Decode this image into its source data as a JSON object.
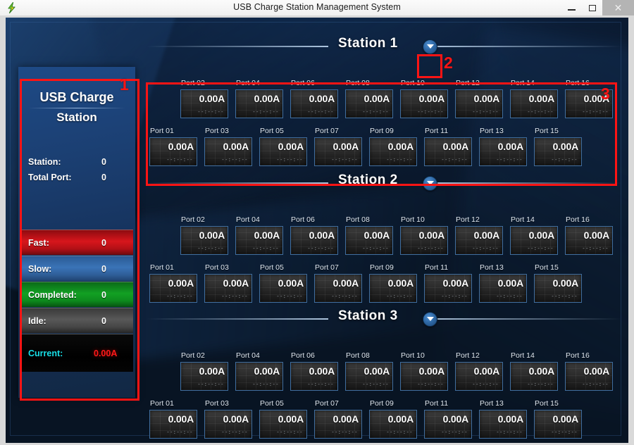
{
  "window": {
    "title": "USB Charge Station Management System",
    "icon": "lightning-bolt-icon",
    "controls": {
      "minimize": "—",
      "maximize": "▢",
      "close": "✕"
    }
  },
  "sidebar": {
    "title_line1": "USB Charge",
    "title_line2": "Station",
    "info": [
      {
        "label": "Station:",
        "value": "0"
      },
      {
        "label": "Total Port:",
        "value": "0"
      }
    ],
    "status": [
      {
        "label": "Fast:",
        "value": "0",
        "color": "#d7161c"
      },
      {
        "label": "Slow:",
        "value": "0",
        "color": "#3a74b7"
      },
      {
        "label": "Completed:",
        "value": "0",
        "color": "#12a023"
      },
      {
        "label": "Idle:",
        "value": "0",
        "color": "#585858"
      },
      {
        "label": "Current:",
        "value": "0.00A",
        "color": "#000000",
        "label_color": "#18e0e8",
        "value_color": "#ff1a1a"
      }
    ]
  },
  "stations": [
    {
      "name": "Station  1",
      "toggle_icon": "chevron-down-icon",
      "ports_top": [
        {
          "label": "Port 02",
          "amps": "0.00A",
          "time": "--:--:--"
        },
        {
          "label": "Port 04",
          "amps": "0.00A",
          "time": "--:--:--"
        },
        {
          "label": "Port 06",
          "amps": "0.00A",
          "time": "--:--:--"
        },
        {
          "label": "Port 08",
          "amps": "0.00A",
          "time": "--:--:--"
        },
        {
          "label": "Port 10",
          "amps": "0.00A",
          "time": "--:--:--"
        },
        {
          "label": "Port 12",
          "amps": "0.00A",
          "time": "--:--:--"
        },
        {
          "label": "Port 14",
          "amps": "0.00A",
          "time": "--:--:--"
        },
        {
          "label": "Port 16",
          "amps": "0.00A",
          "time": "--:--:--"
        }
      ],
      "ports_bottom": [
        {
          "label": "Port 01",
          "amps": "0.00A",
          "time": "--:--:--"
        },
        {
          "label": "Port 03",
          "amps": "0.00A",
          "time": "--:--:--"
        },
        {
          "label": "Port 05",
          "amps": "0.00A",
          "time": "--:--:--"
        },
        {
          "label": "Port 07",
          "amps": "0.00A",
          "time": "--:--:--"
        },
        {
          "label": "Port 09",
          "amps": "0.00A",
          "time": "--:--:--"
        },
        {
          "label": "Port 11",
          "amps": "0.00A",
          "time": "--:--:--"
        },
        {
          "label": "Port 13",
          "amps": "0.00A",
          "time": "--:--:--"
        },
        {
          "label": "Port 15",
          "amps": "0.00A",
          "time": "--:--:--"
        }
      ]
    },
    {
      "name": "Station  2",
      "toggle_icon": "chevron-down-icon",
      "ports_top": [
        {
          "label": "Port 02",
          "amps": "0.00A",
          "time": "--:--:--"
        },
        {
          "label": "Port 04",
          "amps": "0.00A",
          "time": "--:--:--"
        },
        {
          "label": "Port 06",
          "amps": "0.00A",
          "time": "--:--:--"
        },
        {
          "label": "Port 08",
          "amps": "0.00A",
          "time": "--:--:--"
        },
        {
          "label": "Port 10",
          "amps": "0.00A",
          "time": "--:--:--"
        },
        {
          "label": "Port 12",
          "amps": "0.00A",
          "time": "--:--:--"
        },
        {
          "label": "Port 14",
          "amps": "0.00A",
          "time": "--:--:--"
        },
        {
          "label": "Port 16",
          "amps": "0.00A",
          "time": "--:--:--"
        }
      ],
      "ports_bottom": [
        {
          "label": "Port 01",
          "amps": "0.00A",
          "time": "--:--:--"
        },
        {
          "label": "Port 03",
          "amps": "0.00A",
          "time": "--:--:--"
        },
        {
          "label": "Port 05",
          "amps": "0.00A",
          "time": "--:--:--"
        },
        {
          "label": "Port 07",
          "amps": "0.00A",
          "time": "--:--:--"
        },
        {
          "label": "Port 09",
          "amps": "0.00A",
          "time": "--:--:--"
        },
        {
          "label": "Port 11",
          "amps": "0.00A",
          "time": "--:--:--"
        },
        {
          "label": "Port 13",
          "amps": "0.00A",
          "time": "--:--:--"
        },
        {
          "label": "Port 15",
          "amps": "0.00A",
          "time": "--:--:--"
        }
      ]
    },
    {
      "name": "Station  3",
      "toggle_icon": "chevron-down-icon",
      "ports_top": [
        {
          "label": "Port 02",
          "amps": "0.00A",
          "time": "--:--:--"
        },
        {
          "label": "Port 04",
          "amps": "0.00A",
          "time": "--:--:--"
        },
        {
          "label": "Port 06",
          "amps": "0.00A",
          "time": "--:--:--"
        },
        {
          "label": "Port 08",
          "amps": "0.00A",
          "time": "--:--:--"
        },
        {
          "label": "Port 10",
          "amps": "0.00A",
          "time": "--:--:--"
        },
        {
          "label": "Port 12",
          "amps": "0.00A",
          "time": "--:--:--"
        },
        {
          "label": "Port 14",
          "amps": "0.00A",
          "time": "--:--:--"
        },
        {
          "label": "Port 16",
          "amps": "0.00A",
          "time": "--:--:--"
        }
      ],
      "ports_bottom": [
        {
          "label": "Port 01",
          "amps": "0.00A",
          "time": "--:--:--"
        },
        {
          "label": "Port 03",
          "amps": "0.00A",
          "time": "--:--:--"
        },
        {
          "label": "Port 05",
          "amps": "0.00A",
          "time": "--:--:--"
        },
        {
          "label": "Port 07",
          "amps": "0.00A",
          "time": "--:--:--"
        },
        {
          "label": "Port 09",
          "amps": "0.00A",
          "time": "--:--:--"
        },
        {
          "label": "Port 11",
          "amps": "0.00A",
          "time": "--:--:--"
        },
        {
          "label": "Port 13",
          "amps": "0.00A",
          "time": "--:--:--"
        },
        {
          "label": "Port 15",
          "amps": "0.00A",
          "time": "--:--:--"
        }
      ]
    }
  ],
  "annotations": [
    {
      "number": "1",
      "target": "sidebar-panel"
    },
    {
      "number": "2",
      "target": "station-1-toggle"
    },
    {
      "number": "3",
      "target": "station-1-ports"
    }
  ]
}
